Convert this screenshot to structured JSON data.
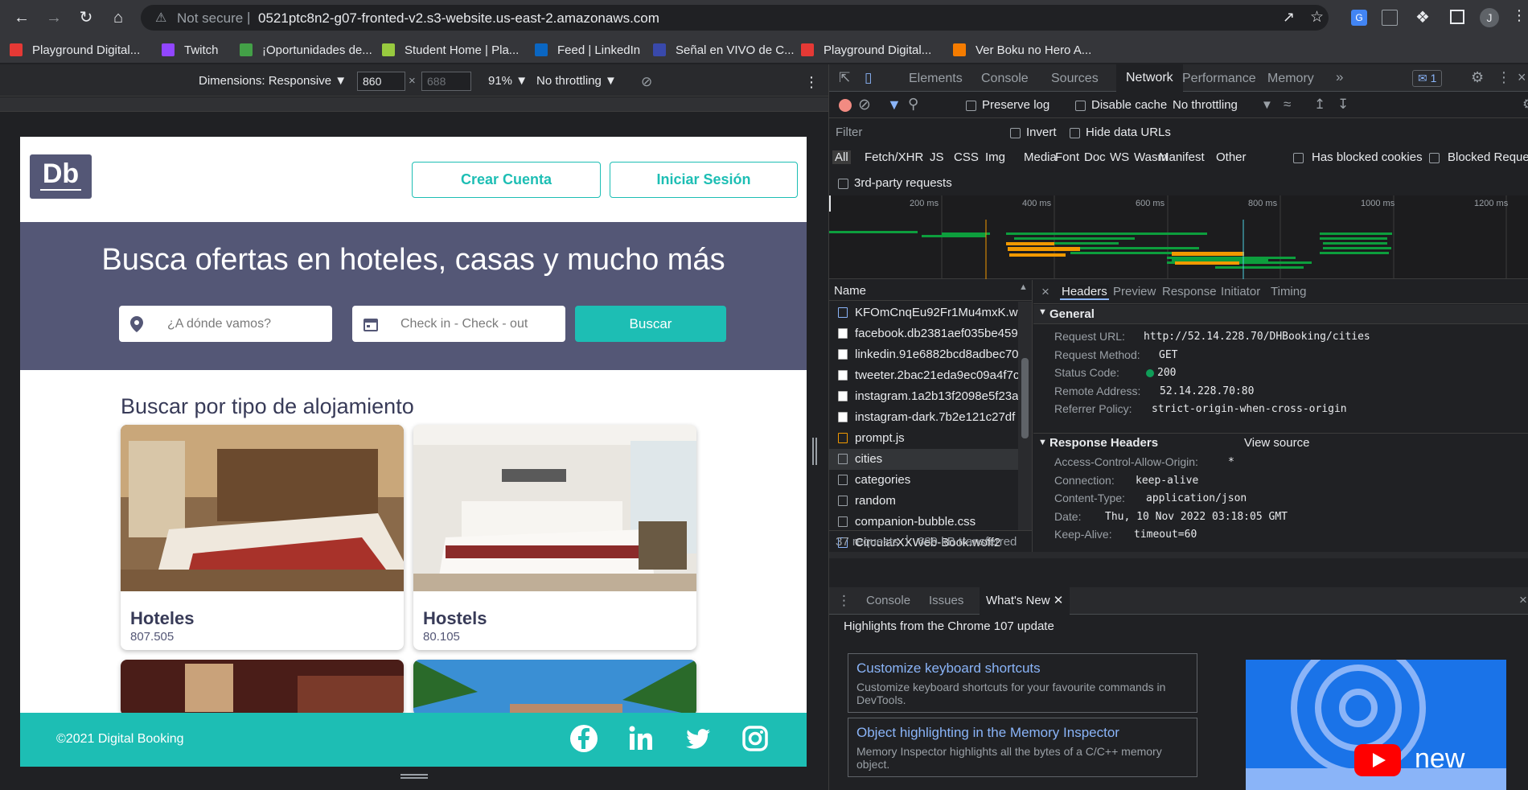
{
  "browser": {
    "security_label": "Not secure",
    "url": "0521ptc8n2-g07-fronted-v2.s3-website.us-east-2.amazonaws.com",
    "profile_initial": "J",
    "bookmarks": [
      {
        "label": "Playground Digital...",
        "icon": "playground-icon",
        "color": "#e53935"
      },
      {
        "label": "Twitch",
        "icon": "twitch-icon",
        "color": "#9146ff"
      },
      {
        "label": "¡Oportunidades de...",
        "icon": "bookmark-icon",
        "color": "#43a047"
      },
      {
        "label": "Student Home | Pla...",
        "icon": "platzi-icon",
        "color": "#98ca3f"
      },
      {
        "label": "Feed | LinkedIn",
        "icon": "linkedin-icon",
        "color": "#0a66c2"
      },
      {
        "label": "Señal en VIVO de C...",
        "icon": "channel-icon",
        "color": "#3949ab"
      },
      {
        "label": "Playground Digital...",
        "icon": "playground-icon",
        "color": "#e53935"
      },
      {
        "label": "Ver Boku no Hero A...",
        "icon": "anime-icon",
        "color": "#f57c00"
      }
    ]
  },
  "device_toolbar": {
    "dimensions_label": "Dimensions: Responsive ▼",
    "width": "860",
    "height": "688",
    "zoom": "91% ▼",
    "throttle": "No throttling ▼"
  },
  "page": {
    "logo_text": "Db",
    "create_account": "Crear Cuenta",
    "login": "Iniciar Sesión",
    "hero_title": "Busca ofertas en hoteles, casas y mucho más",
    "destination_placeholder": "¿A dónde vamos?",
    "dates_placeholder": "Check in - Check - out",
    "search_button": "Buscar",
    "section_title": "Buscar por tipo de alojamiento",
    "cards": [
      {
        "name": "Hoteles",
        "count": "807.505"
      },
      {
        "name": "Hostels",
        "count": "80.105"
      }
    ],
    "footer_copyright": "©2021 Digital Booking"
  },
  "devtools": {
    "tabs": [
      "Elements",
      "Console",
      "Sources",
      "Network",
      "Performance",
      "Memory"
    ],
    "selected_tab": "Network",
    "issues_count": "1",
    "net_options": {
      "preserve_log": "Preserve log",
      "disable_cache": "Disable cache",
      "throttling": "No throttling"
    },
    "filter_placeholder": "Filter",
    "invert": "Invert",
    "hide_data_urls": "Hide data URLs",
    "type_filters": [
      "All",
      "Fetch/XHR",
      "JS",
      "CSS",
      "Img",
      "Media",
      "Font",
      "Doc",
      "WS",
      "Wasm",
      "Manifest",
      "Other"
    ],
    "has_blocked_cookies": "Has blocked cookies",
    "blocked_requests": "Blocked Reque",
    "third_party": "3rd-party requests",
    "timeline_ticks": [
      "200 ms",
      "400 ms",
      "600 ms",
      "800 ms",
      "1000 ms",
      "1200 ms"
    ],
    "name_header": "Name",
    "requests": [
      "KFOmCnqEu92Fr1Mu4mxK.wo",
      "facebook.db2381aef035be459",
      "linkedin.91e6882bcd8adbec70",
      "tweeter.2bac21eda9ec09a4f7c",
      "instagram.1a2b13f2098e5f23a",
      "instagram-dark.7b2e121c27df",
      "prompt.js",
      "cities",
      "categories",
      "random",
      "companion-bubble.css",
      "CircularXXWeb-Book.woff2"
    ],
    "summary_requests": "37 requests",
    "summary_transferred": "689 kB transferred",
    "detail_tabs": [
      "Headers",
      "Preview",
      "Response",
      "Initiator",
      "Timing"
    ],
    "general_title": "General",
    "general": [
      {
        "k": "Request URL:",
        "v": "http://52.14.228.70/DHBooking/cities"
      },
      {
        "k": "Request Method:",
        "v": "GET"
      },
      {
        "k": "Status Code:",
        "v": "200"
      },
      {
        "k": "Remote Address:",
        "v": "52.14.228.70:80"
      },
      {
        "k": "Referrer Policy:",
        "v": "strict-origin-when-cross-origin"
      }
    ],
    "response_headers_title": "Response Headers",
    "view_source": "View source",
    "response_headers": [
      {
        "k": "Access-Control-Allow-Origin:",
        "v": "*"
      },
      {
        "k": "Connection:",
        "v": "keep-alive"
      },
      {
        "k": "Content-Type:",
        "v": "application/json"
      },
      {
        "k": "Date:",
        "v": "Thu, 10 Nov 2022 03:18:05 GMT"
      },
      {
        "k": "Keep-Alive:",
        "v": "timeout=60"
      }
    ],
    "drawer_tabs": [
      "Console",
      "Issues",
      "What's New"
    ],
    "whats_new_title": "Highlights from the Chrome 107 update",
    "whats_new_items": [
      {
        "title": "Customize keyboard shortcuts",
        "desc": "Customize keyboard shortcuts for your favourite commands in DevTools."
      },
      {
        "title": "Object highlighting in the Memory Inspector",
        "desc": "Memory Inspector highlights all the bytes of a C/C++ memory object."
      }
    ],
    "video_label": "new"
  }
}
